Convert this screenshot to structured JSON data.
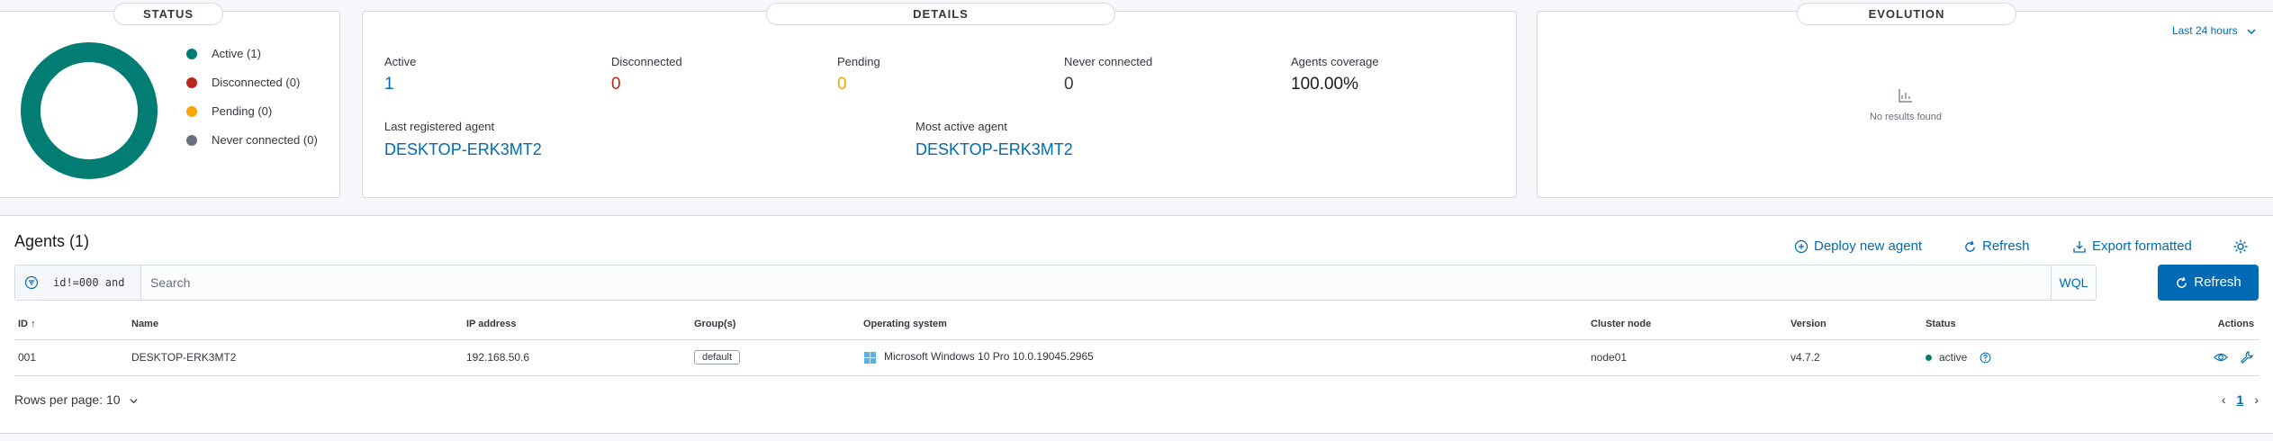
{
  "status": {
    "title": "STATUS",
    "legend": [
      {
        "label": "Active (1)",
        "color": "#017d73"
      },
      {
        "label": "Disconnected (0)",
        "color": "#bd271e"
      },
      {
        "label": "Pending (0)",
        "color": "#f5a700"
      },
      {
        "label": "Never connected (0)",
        "color": "#69707d"
      }
    ]
  },
  "details": {
    "title": "DETAILS",
    "stats": [
      {
        "label": "Active",
        "value": "1",
        "color": "#006bb4"
      },
      {
        "label": "Disconnected",
        "value": "0",
        "color": "#bd271e"
      },
      {
        "label": "Pending",
        "value": "0",
        "color": "#f5a700"
      },
      {
        "label": "Never connected",
        "value": "0",
        "color": "#343741"
      },
      {
        "label": "Agents coverage",
        "value": "100.00%",
        "color": "#1a1c21"
      }
    ],
    "last_registered_label": "Last registered agent",
    "last_registered_value": "DESKTOP-ERK3MT2",
    "most_active_label": "Most active agent",
    "most_active_value": "DESKTOP-ERK3MT2"
  },
  "evolution": {
    "title": "EVOLUTION",
    "range": "Last 24 hours",
    "empty": "No results found"
  },
  "agents": {
    "heading": "Agents (1)",
    "deploy": "Deploy new agent",
    "refresh_link": "Refresh",
    "export": "Export formatted",
    "search_query": "id!=000 and",
    "search_placeholder": "Search",
    "wql": "WQL",
    "refresh_button": "Refresh",
    "columns": [
      "ID",
      "Name",
      "IP address",
      "Group(s)",
      "Operating system",
      "Cluster node",
      "Version",
      "Status",
      "Actions"
    ],
    "rows": [
      {
        "id": "001",
        "name": "DESKTOP-ERK3MT2",
        "ip": "192.168.50.6",
        "group": "default",
        "os": "Microsoft Windows 10 Pro 10.0.19045.2965",
        "node": "node01",
        "version": "v4.7.2",
        "status": "active"
      }
    ],
    "rows_per_page": "Rows per page: 10",
    "page": "1"
  }
}
